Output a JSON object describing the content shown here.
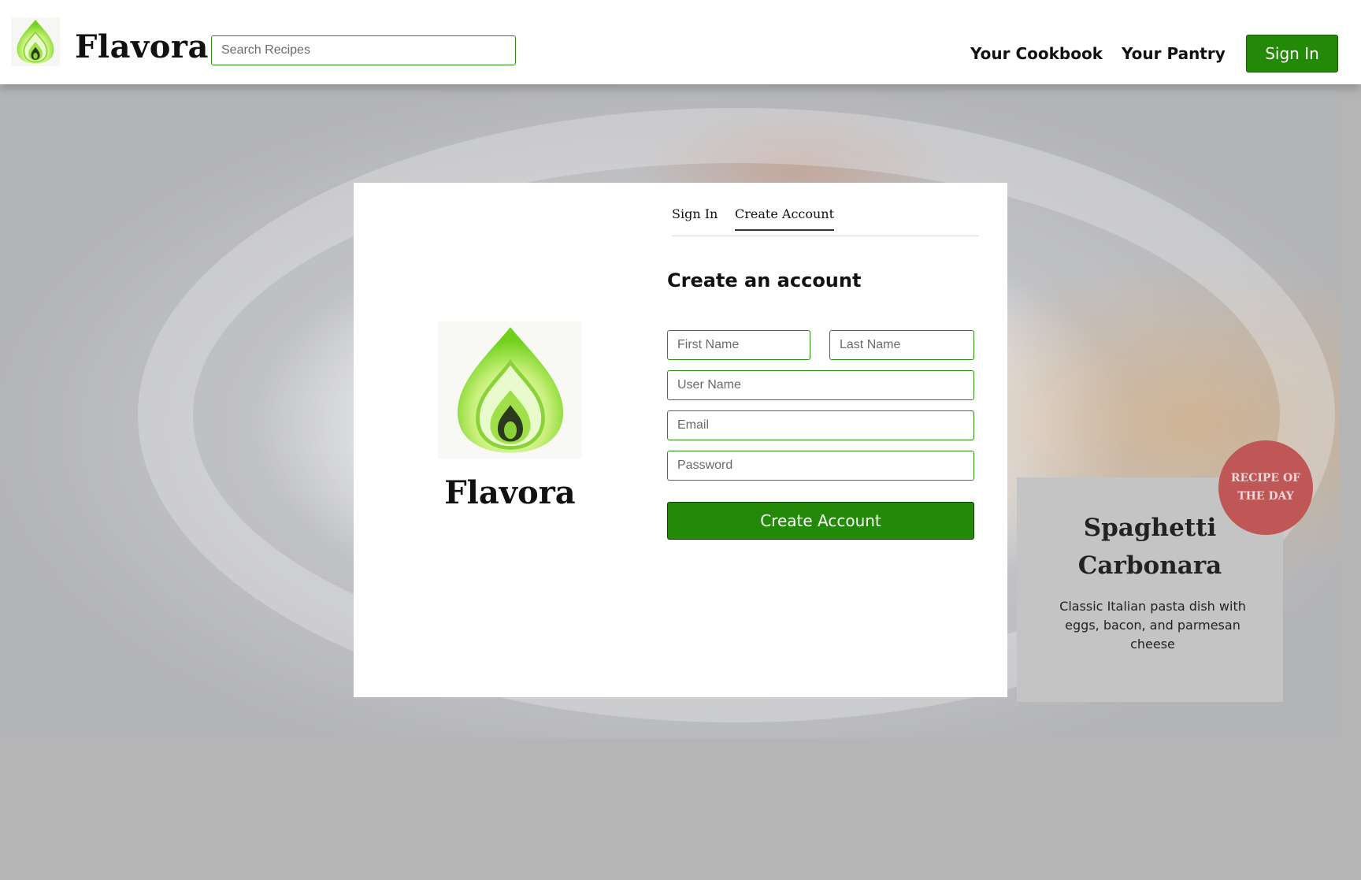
{
  "header": {
    "logo_icon": "flavora-flame-logo-icon",
    "brand": "Flavora",
    "search_placeholder": "Search Recipes",
    "nav": {
      "cookbook": "Your Cookbook",
      "pantry": "Your Pantry"
    },
    "signin_label": "Sign In"
  },
  "modal": {
    "logo_icon": "flavora-flame-logo-icon",
    "brand": "Flavora",
    "tabs": {
      "signin": "Sign In",
      "create": "Create Account",
      "active": "Create Account"
    },
    "heading": "Create an account",
    "fields": {
      "first_name": "First Name",
      "last_name": "Last Name",
      "user_name": "User Name",
      "email": "Email",
      "password": "Password"
    },
    "submit_label": "Create Account"
  },
  "recipe_of_day": {
    "badge": "RECIPE OF THE DAY",
    "title": "Spaghetti Carbonara",
    "description": "Classic Italian pasta dish with eggs, bacon, and parmesan cheese"
  },
  "colors": {
    "accent": "#238a08",
    "badge": "#c05757",
    "page_background": "#b5b5b5"
  }
}
